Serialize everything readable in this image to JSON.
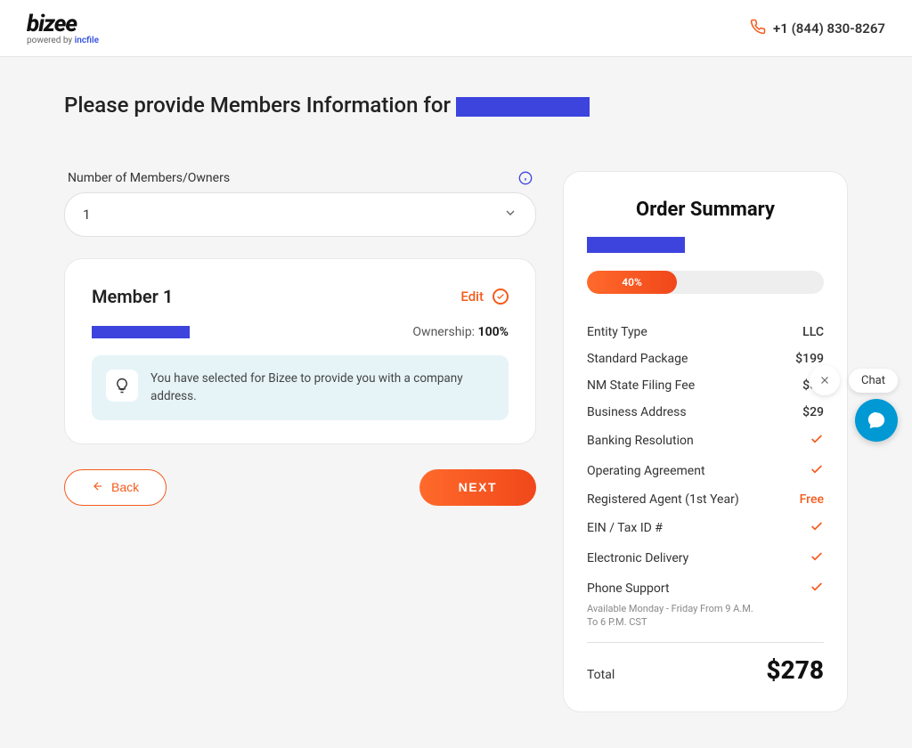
{
  "header": {
    "logo_main": "bizee",
    "logo_sub_prefix": "powered by ",
    "logo_sub_brand": "incfile",
    "phone": "+1 (844) 830-8267"
  },
  "page": {
    "title_prefix": "Please provide Members Information for "
  },
  "members_field": {
    "label": "Number of Members/Owners",
    "value": "1"
  },
  "member_card": {
    "title": "Member 1",
    "edit_label": "Edit",
    "ownership_label": "Ownership: ",
    "ownership_pct": "100%",
    "note_text": "You have selected for Bizee to provide you with a company address."
  },
  "nav": {
    "back": "Back",
    "next": "NEXT"
  },
  "summary": {
    "title": "Order Summary",
    "progress_pct": "40%",
    "progress_width": "38%",
    "rows": [
      {
        "label": "Entity Type",
        "value": "LLC",
        "type": "text"
      },
      {
        "label": "Standard Package",
        "value": "$199",
        "type": "text"
      },
      {
        "label": "NM State Filing Fee",
        "value": "$50",
        "type": "text"
      },
      {
        "label": "Business Address",
        "value": "$29",
        "type": "text"
      },
      {
        "label": "Banking Resolution",
        "type": "check"
      },
      {
        "label": "Operating Agreement",
        "type": "check"
      },
      {
        "label": "Registered Agent (1st Year)",
        "value": "Free",
        "type": "free"
      },
      {
        "label": "EIN / Tax ID #",
        "type": "check"
      },
      {
        "label": "Electronic Delivery",
        "type": "check"
      },
      {
        "label": "Phone Support",
        "type": "check",
        "note": "Available Monday - Friday From 9 A.M. To 6 P.M. CST"
      }
    ],
    "total_label": "Total",
    "total_value": "$278"
  },
  "chat": {
    "label": "Chat"
  }
}
